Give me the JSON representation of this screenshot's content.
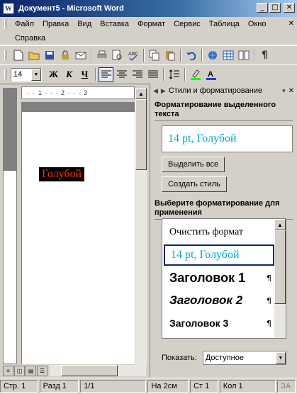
{
  "window": {
    "title": "Документ5 - Microsoft Word",
    "app_icon": "W",
    "controls": {
      "minimize": "_",
      "maximize": "□",
      "close": "✕"
    }
  },
  "menu": {
    "items": [
      "Файл",
      "Правка",
      "Вид",
      "Вставка",
      "Формат",
      "Сервис",
      "Таблица",
      "Окно",
      "Справка"
    ],
    "close_doc": "✕"
  },
  "toolbar_standard": {
    "icons": [
      "new-document-icon",
      "open-icon",
      "save-icon",
      "permission-icon",
      "email-icon",
      "print-icon",
      "print-preview-icon",
      "spelling-icon",
      "copy-icon",
      "paste-icon",
      "undo-icon",
      "hyperlink-icon",
      "table-icon",
      "columns-icon",
      "paragraph-mark-icon"
    ]
  },
  "toolbar_formatting": {
    "font_size": "14",
    "bold": "Ж",
    "italic": "К",
    "underline": "Ч"
  },
  "document": {
    "text": "Голубой",
    "text_color": "#ff3300",
    "highlight": "#000000",
    "ruler_marks": "· · 1 · · · 2 · · · 3"
  },
  "task_pane": {
    "title": "Стили и форматирование",
    "selected_heading": "Форматирование выделенного текста",
    "selected_format": "14 pt, Голубой",
    "select_all_button": "Выделить все",
    "new_style_button": "Создать стиль",
    "pick_heading": "Выберите форматирование для применения",
    "styles": [
      "Очистить формат",
      "14 pt, Голубой",
      "Заголовок 1",
      "Заголовок 2",
      "Заголовок 3"
    ],
    "paragraph_mark": "¶",
    "show_label": "Показать:",
    "show_value": "Доступное",
    "accent_color": "#00aacc"
  },
  "status": {
    "page": "Стр. 1",
    "section": "Разд 1",
    "pages": "1/1",
    "position": "На 2см",
    "line": "Ст 1",
    "column": "Кол 1",
    "rec": "ЗА"
  }
}
